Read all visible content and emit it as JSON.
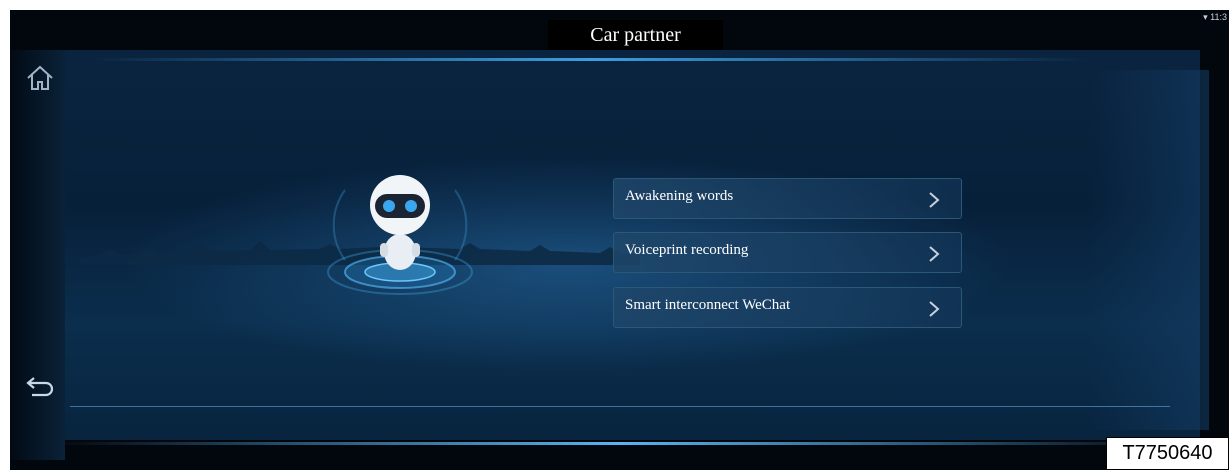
{
  "header": {
    "title": "Car partner"
  },
  "status_bar": {
    "time": "11:3"
  },
  "sidebar": {
    "home_icon": "home-icon",
    "back_icon": "back-icon"
  },
  "menu": {
    "items": [
      {
        "label": "Awakening words"
      },
      {
        "label": "Voiceprint recording"
      },
      {
        "label": "Smart interconnect WeChat"
      }
    ]
  },
  "figure_code": "T7750640",
  "colors": {
    "accent": "#3d9ee0",
    "background": "#02060d",
    "menu_border": "#2b5778"
  }
}
